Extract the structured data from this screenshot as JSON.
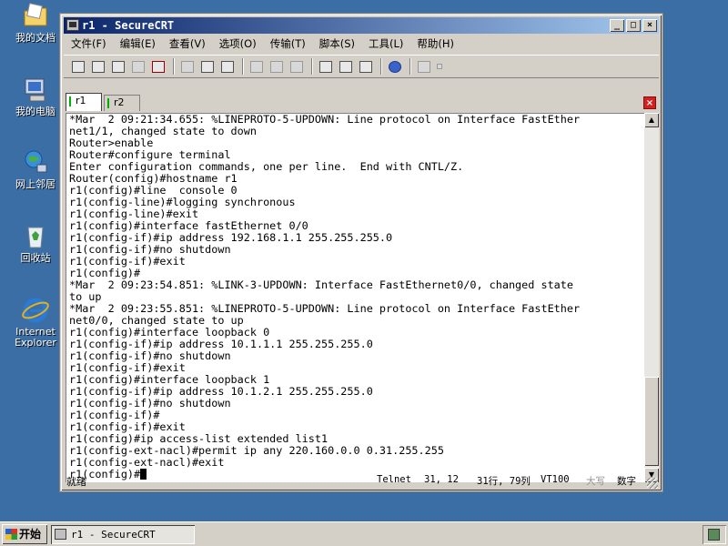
{
  "desktop": {
    "icons": [
      {
        "label": "我的文档",
        "icon": "my-documents-icon"
      },
      {
        "label": "我的电脑",
        "icon": "my-computer-icon"
      },
      {
        "label": "网上邻居",
        "icon": "network-places-icon"
      },
      {
        "label": "回收站",
        "icon": "recycle-bin-icon"
      },
      {
        "label": "Internet Explorer",
        "icon": "internet-explorer-icon"
      }
    ]
  },
  "window": {
    "title": "r1 - SecureCRT",
    "buttons": {
      "minimize": "_",
      "maximize": "□",
      "close": "×"
    }
  },
  "menu": {
    "items": [
      "文件(F)",
      "编辑(E)",
      "查看(V)",
      "选项(O)",
      "传输(T)",
      "脚本(S)",
      "工具(L)",
      "帮助(H)"
    ]
  },
  "tabs": {
    "items": [
      {
        "label": "r1",
        "active": true
      },
      {
        "label": "r2",
        "active": false
      }
    ],
    "close": "×"
  },
  "terminal": {
    "lines": [
      "*Mar  2 09:21:34.655: %LINEPROTO-5-UPDOWN: Line protocol on Interface FastEther",
      "net1/1, changed state to down",
      "Router>enable",
      "Router#configure terminal",
      "Enter configuration commands, one per line.  End with CNTL/Z.",
      "Router(config)#hostname r1",
      "r1(config)#line  console 0",
      "r1(config-line)#logging synchronous",
      "r1(config-line)#exit",
      "r1(config)#interface fastEthernet 0/0",
      "r1(config-if)#ip address 192.168.1.1 255.255.255.0",
      "r1(config-if)#no shutdown",
      "r1(config-if)#exit",
      "r1(config)#",
      "*Mar  2 09:23:54.851: %LINK-3-UPDOWN: Interface FastEthernet0/0, changed state",
      "to up",
      "*Mar  2 09:23:55.851: %LINEPROTO-5-UPDOWN: Line protocol on Interface FastEther",
      "net0/0, changed state to up",
      "r1(config)#interface loopback 0",
      "r1(config-if)#ip address 10.1.1.1 255.255.255.0",
      "r1(config-if)#no shutdown",
      "r1(config-if)#exit",
      "r1(config)#interface loopback 1",
      "r1(config-if)#ip address 10.1.2.1 255.255.255.0",
      "r1(config-if)#no shutdown",
      "r1(config-if)#",
      "r1(config-if)#exit",
      "r1(config)#ip access-list extended list1",
      "r1(config-ext-nacl)#permit ip any 220.160.0.0 0.31.255.255",
      "r1(config-ext-nacl)#exit"
    ],
    "prompt": "r1(config)#"
  },
  "status": {
    "ready": "就绪",
    "protocol": "Telnet",
    "position": "31,  12",
    "size": "31行, 79列",
    "emulation": "VT100",
    "caps": "大写",
    "num": "数字"
  },
  "taskbar": {
    "start": "开始",
    "task": "r1 - SecureCRT"
  }
}
